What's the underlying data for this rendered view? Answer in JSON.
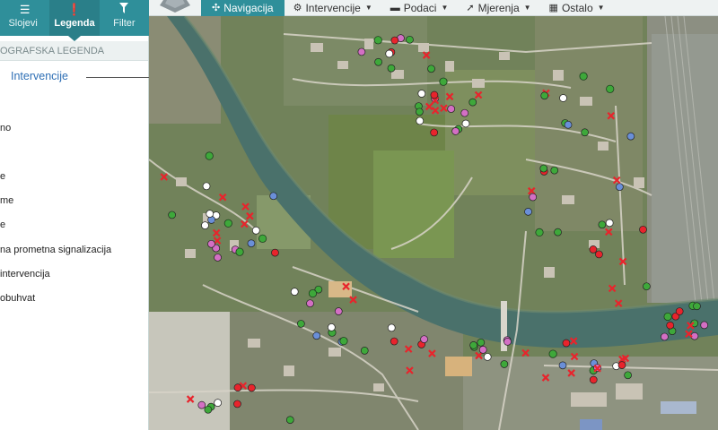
{
  "sidebar": {
    "tabs": [
      {
        "label": "Slojevi",
        "icon": "menu-icon"
      },
      {
        "label": "Legenda",
        "icon": "info-icon",
        "active": true
      },
      {
        "label": "Filter",
        "icon": "filter-icon"
      }
    ],
    "legend_header": "OGRAFSKA LEGENDA",
    "legend_section": "Intervencije",
    "legend_items": [
      "no",
      "e",
      "me",
      "e",
      "na prometna signalizacija",
      "intervencija",
      "obuhvat"
    ]
  },
  "navbar": {
    "items": [
      {
        "label": "Navigacija",
        "icon": "compass-icon",
        "active": true,
        "dropdown": false
      },
      {
        "label": "Intervencije",
        "icon": "gear-icon",
        "dropdown": true
      },
      {
        "label": "Podaci",
        "icon": "database-icon",
        "dropdown": true
      },
      {
        "label": "Mjerenja",
        "icon": "ruler-icon",
        "dropdown": true
      },
      {
        "label": "Ostalo",
        "icon": "grid-icon",
        "dropdown": true
      }
    ]
  },
  "colors": {
    "accent": "#2f8f9a",
    "link": "#2e6fb5",
    "river": "#486f6a",
    "marker_red": "#e8242c",
    "marker_green": "#3ea83a",
    "marker_pink": "#d36fc4",
    "marker_blue": "#6a8fd8"
  }
}
